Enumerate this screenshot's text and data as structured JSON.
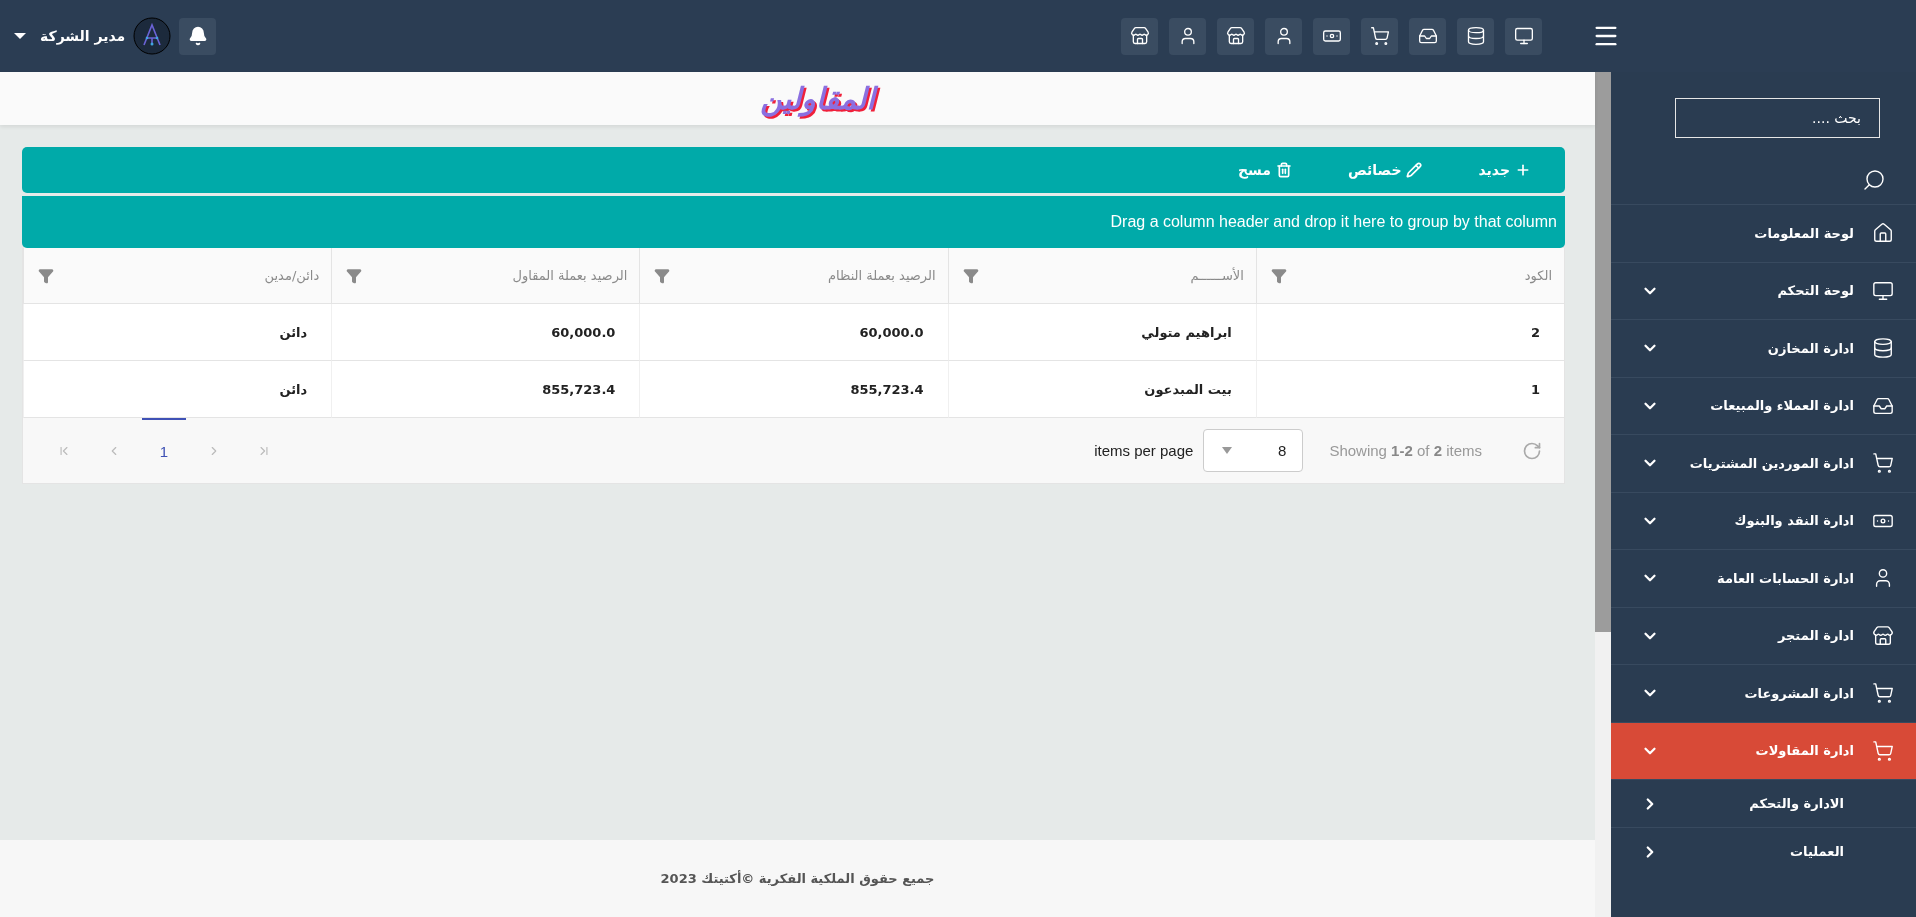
{
  "topbar": {
    "user_name": "مدير الشركة"
  },
  "sidebar": {
    "search": {
      "placeholder": "بحث ...."
    },
    "items": [
      {
        "label": "لوحة المعلومات",
        "kind": "link",
        "selected": false
      },
      {
        "label": "لوحة التحكم",
        "kind": "group",
        "selected": false
      },
      {
        "label": "ادارة المخازن",
        "kind": "group",
        "selected": false
      },
      {
        "label": "ادارة العملاء والمبيعات",
        "kind": "group",
        "selected": false
      },
      {
        "label": "ادارة الموردين المشتريات",
        "kind": "group",
        "selected": false
      },
      {
        "label": "ادارة النقد والبنوك",
        "kind": "group",
        "selected": false
      },
      {
        "label": "ادارة الحسابات العامة",
        "kind": "group",
        "selected": false
      },
      {
        "label": "ادارة المتجر",
        "kind": "group",
        "selected": false
      },
      {
        "label": "ادارة المشروعات",
        "kind": "group",
        "selected": false
      },
      {
        "label": "ادارة المقاولات",
        "kind": "group",
        "selected": true,
        "children": [
          {
            "label": "الادارة والتحكم"
          },
          {
            "label": "العمليات"
          }
        ]
      }
    ]
  },
  "page": {
    "title": "المقاولين"
  },
  "toolbar": [
    {
      "label": "جديد"
    },
    {
      "label": "خصائص"
    },
    {
      "label": "مسح"
    }
  ],
  "group_bar": "Drag a column header and drop it here to group by that column",
  "table": {
    "columns": [
      "الكود",
      "الأســــــم",
      "الرصيد بعملة النظام",
      "الرصيد بعملة المقاول",
      "دائن/مدين"
    ],
    "rows": [
      [
        "2",
        "ابراهيم متولي",
        "60,000.0",
        "60,000.0",
        "دائن"
      ],
      [
        "1",
        "بيت المبدعون",
        "855,723.4",
        "855,723.4",
        "دائن"
      ]
    ]
  },
  "pager": {
    "pages": [
      {
        "label": "1",
        "selected": true
      }
    ],
    "page_size": "8",
    "page_size_label": "items per page",
    "summary": "Showing **1-2** of **2** items"
  },
  "footer": "جميع حقوق الملكية الفكرية ©أكتيتك 2023"
}
